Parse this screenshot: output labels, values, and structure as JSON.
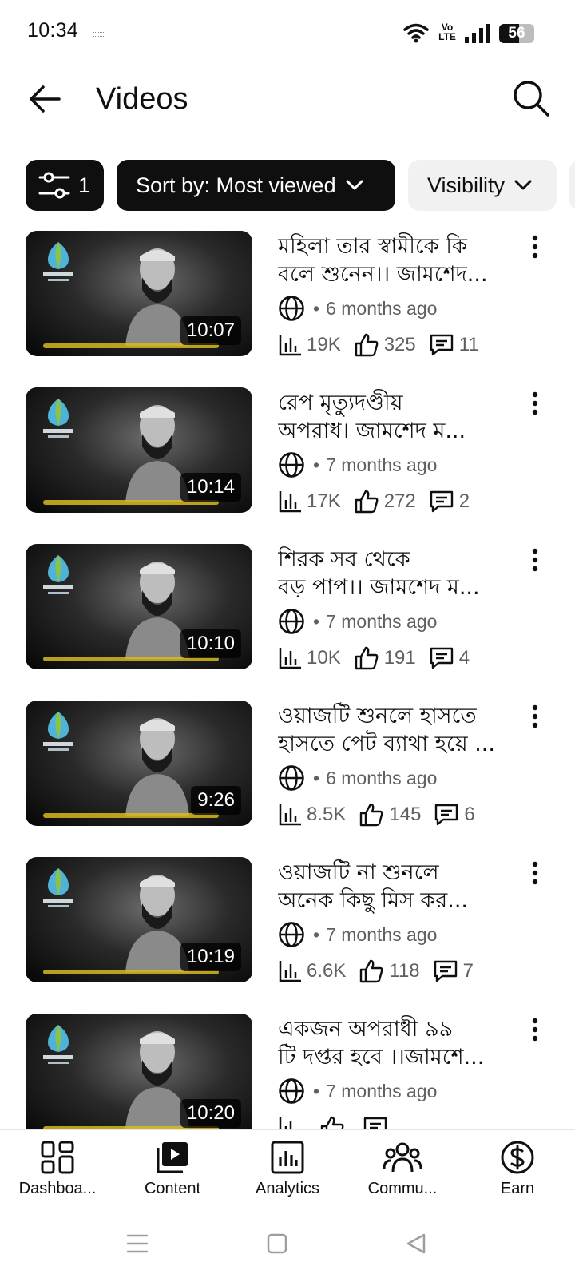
{
  "status_bar": {
    "time": "10:34",
    "network": "Vo LTE",
    "battery": "56"
  },
  "header": {
    "title": "Videos"
  },
  "chips": {
    "filter_count": "1",
    "sort_label": "Sort by: Most viewed",
    "visibility_label": "Visibility"
  },
  "videos": [
    {
      "title_line1": "মহিলা তার স্বামীকে কি",
      "title_line2": "বলে শুনেন।। জামশেদ...",
      "duration": "10:07",
      "published": "6 months ago",
      "views": "19K",
      "likes": "325",
      "comments": "11"
    },
    {
      "title_line1": "রেপ মৃত্যুদণ্ডীয়",
      "title_line2": "অপরাধ। জামশেদ ম...",
      "duration": "10:14",
      "published": "7 months ago",
      "views": "17K",
      "likes": "272",
      "comments": "2"
    },
    {
      "title_line1": "শিরক সব থেকে",
      "title_line2": "বড় পাপ।। জামশেদ ম...",
      "duration": "10:10",
      "published": "7 months ago",
      "views": "10K",
      "likes": "191",
      "comments": "4"
    },
    {
      "title_line1": "ওয়াজটি শুনলে হাসতে",
      "title_line2": "হাসতে পেট ব্যাথা হয়ে ...",
      "duration": "9:26",
      "published": "6 months ago",
      "views": "8.5K",
      "likes": "145",
      "comments": "6"
    },
    {
      "title_line1": "ওয়াজটি না শুনলে",
      "title_line2": "অনেক কিছু মিস কর...",
      "duration": "10:19",
      "published": "7 months ago",
      "views": "6.6K",
      "likes": "118",
      "comments": "7"
    },
    {
      "title_line1": "একজন অপরাধী ৯৯",
      "title_line2": "টি দপ্তর হবে ।।জামশে...",
      "duration": "10:20",
      "published": "7 months ago",
      "views": "",
      "likes": "",
      "comments": ""
    }
  ],
  "bottom_nav": [
    {
      "label": "Dashboa...",
      "icon": "dashboard-icon"
    },
    {
      "label": "Content",
      "icon": "content-icon"
    },
    {
      "label": "Analytics",
      "icon": "analytics-icon"
    },
    {
      "label": "Commu...",
      "icon": "community-icon"
    },
    {
      "label": "Earn",
      "icon": "earn-icon"
    }
  ]
}
